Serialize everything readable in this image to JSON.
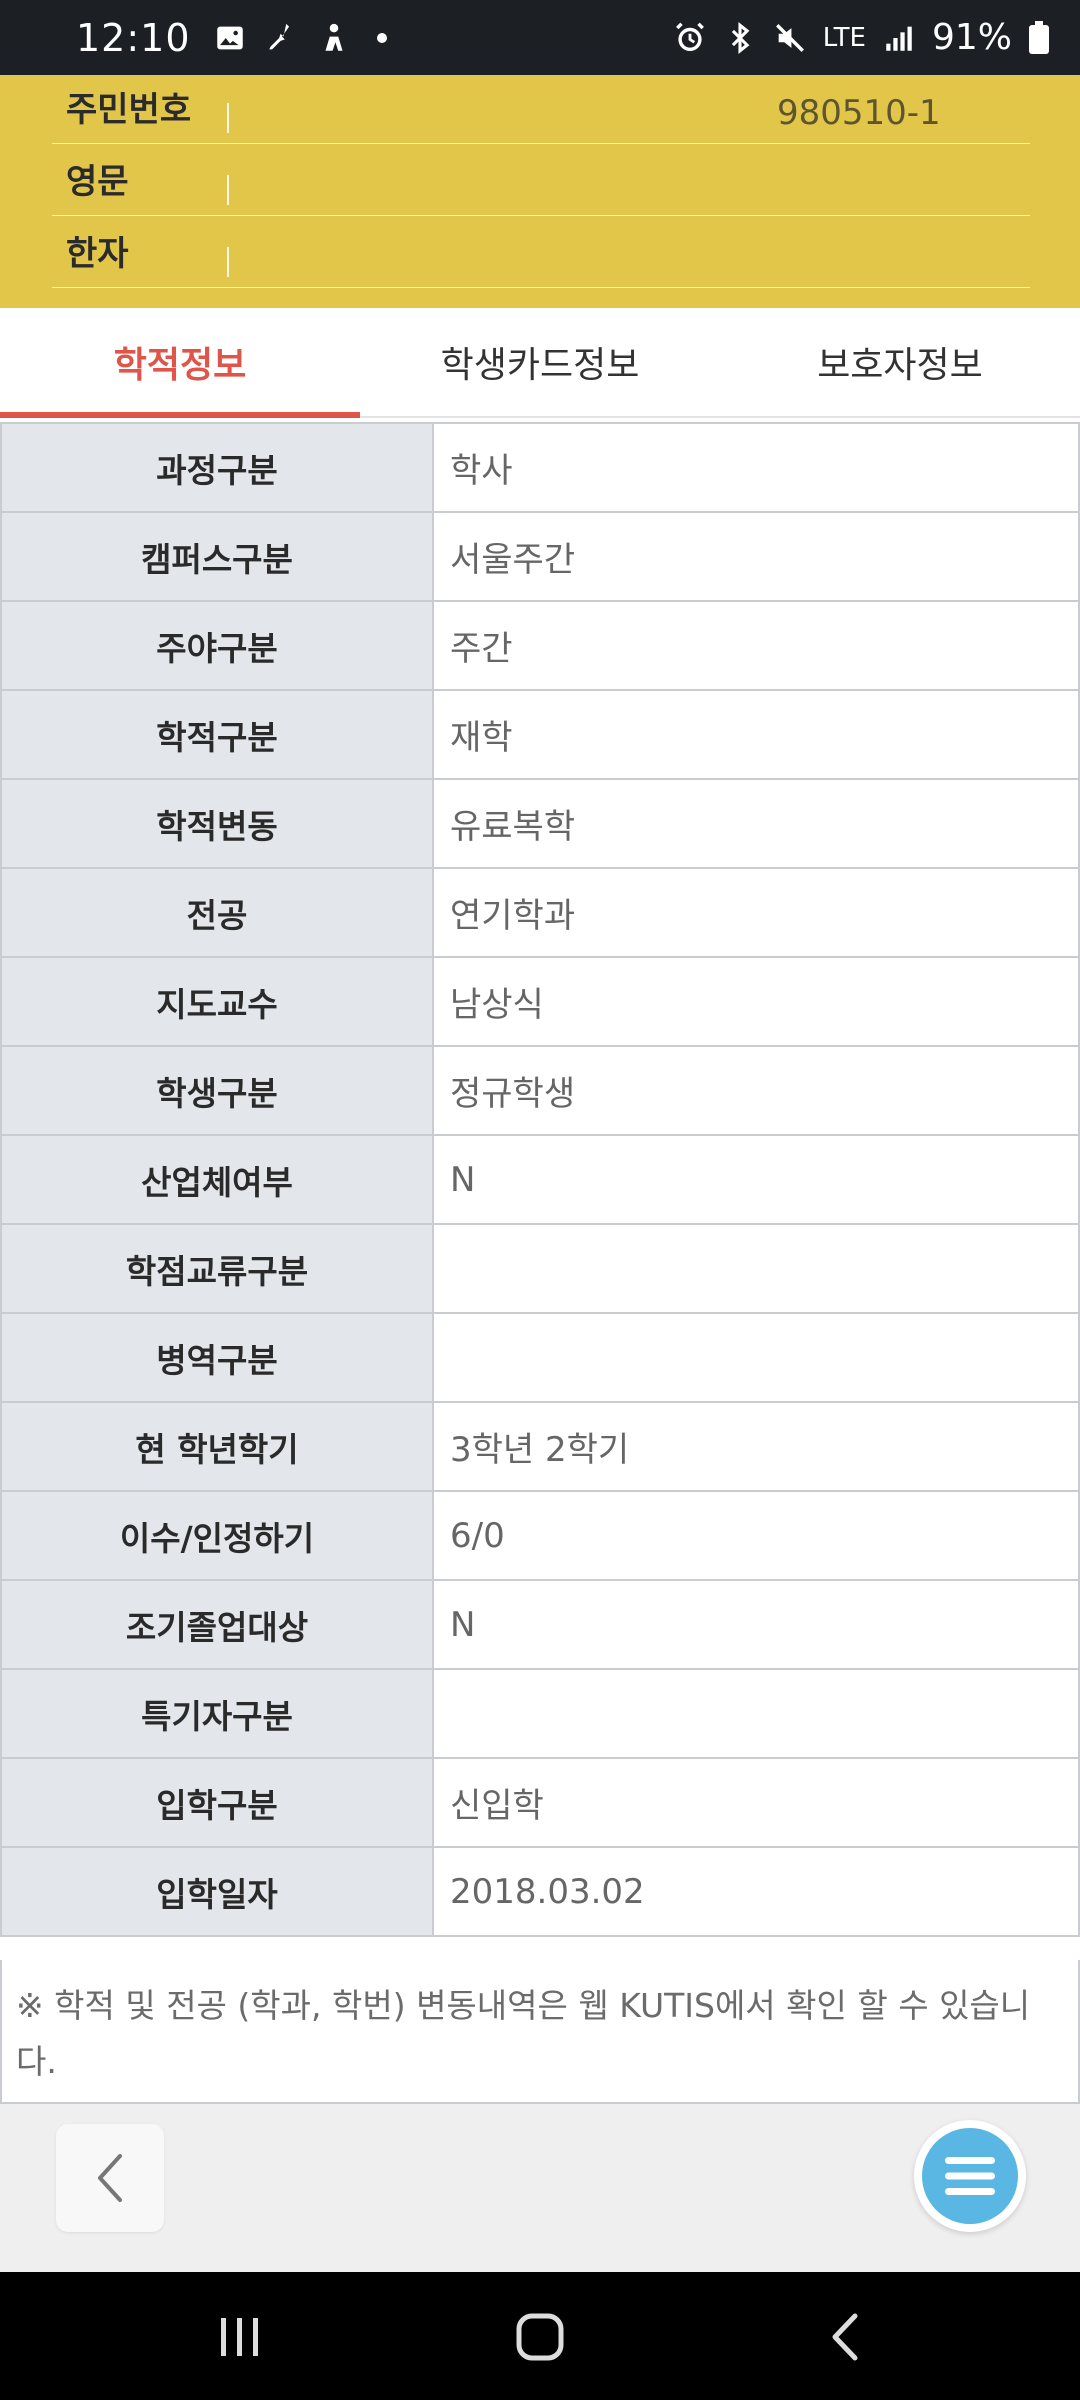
{
  "status_bar": {
    "time": "12:10",
    "network": "LTE",
    "battery": "91%"
  },
  "profile": {
    "rows": [
      {
        "label": "주민번호",
        "value": "980510-1"
      },
      {
        "label": "영문",
        "value": ""
      },
      {
        "label": "한자",
        "value": ""
      }
    ]
  },
  "tabs": [
    {
      "label": "학적정보",
      "active": true
    },
    {
      "label": "학생카드정보",
      "active": false
    },
    {
      "label": "보호자정보",
      "active": false
    }
  ],
  "info": [
    {
      "key": "과정구분",
      "value": "학사"
    },
    {
      "key": "캠퍼스구분",
      "value": "서울주간"
    },
    {
      "key": "주야구분",
      "value": "주간"
    },
    {
      "key": "학적구분",
      "value": "재학"
    },
    {
      "key": "학적변동",
      "value": "유료복학"
    },
    {
      "key": "전공",
      "value": "연기학과"
    },
    {
      "key": "지도교수",
      "value": "남상식"
    },
    {
      "key": "학생구분",
      "value": "정규학생"
    },
    {
      "key": "산업체여부",
      "value": "N"
    },
    {
      "key": "학점교류구분",
      "value": ""
    },
    {
      "key": "병역구분",
      "value": ""
    },
    {
      "key": "현 학년학기",
      "value": "3학년 2학기"
    },
    {
      "key": "이수/인정하기",
      "value": "6/0"
    },
    {
      "key": "조기졸업대상",
      "value": "N"
    },
    {
      "key": "특기자구분",
      "value": ""
    },
    {
      "key": "입학구분",
      "value": "신입학"
    },
    {
      "key": "입학일자",
      "value": "2018.03.02"
    }
  ],
  "notice": "※ 학적 및 전공 (학과, 학번) 변동내역은 웹 KUTIS에서 확인 할 수 있습니다.",
  "icons": {
    "back": "chevron-left-icon",
    "menu": "hamburger-menu-icon",
    "nav_recents": "recents-icon",
    "nav_home": "home-icon",
    "nav_back": "back-icon"
  },
  "colors": {
    "header_yellow": "#e2c64a",
    "active_tab": "#e0554a",
    "menu_blue": "#5ab7e3"
  }
}
